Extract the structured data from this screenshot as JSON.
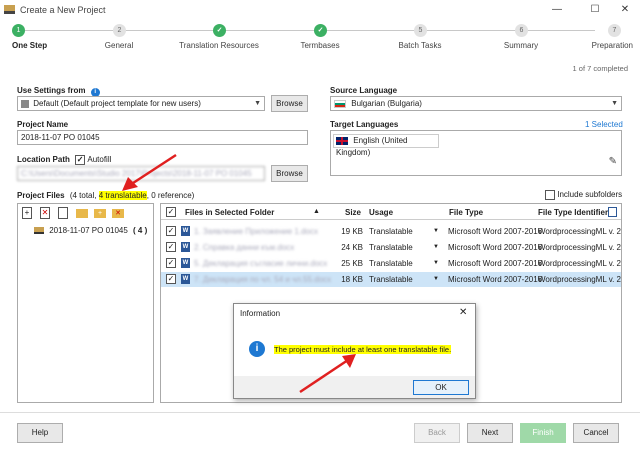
{
  "window": {
    "title": "Create a New Project"
  },
  "steps": [
    {
      "num": "1",
      "label": "One Step",
      "state": "current"
    },
    {
      "num": "2",
      "label": "General",
      "state": "todo"
    },
    {
      "num": "✓",
      "label": "Translation Resources",
      "state": "done"
    },
    {
      "num": "✓",
      "label": "Termbases",
      "state": "done"
    },
    {
      "num": "5",
      "label": "Batch Tasks",
      "state": "todo"
    },
    {
      "num": "6",
      "label": "Summary",
      "state": "todo"
    },
    {
      "num": "7",
      "label": "Preparation",
      "state": "todo"
    }
  ],
  "progress": "1 of 7 completed",
  "settings": {
    "use_settings_label": "Use Settings from",
    "use_settings_value": "Default (Default project template for new users)",
    "browse_label": "Browse",
    "project_name_label": "Project Name",
    "project_name_value": "2018-11-07 PO 01045",
    "location_label": "Location Path",
    "autofill_label": "Autofill",
    "location_value": "C:\\Users\\Documents\\Studio 2017\\Projects\\2018-11-07 PO 01045"
  },
  "languages": {
    "source_label": "Source Language",
    "source_value": "Bulgarian (Bulgaria)",
    "target_label": "Target Languages",
    "target_selected": "1 Selected",
    "target_value": "English (United Kingdom)"
  },
  "files": {
    "label": "Project Files",
    "count_prefix": "(4 total, ",
    "count_highlight": "4 translatable",
    "count_suffix": ", 0 reference)",
    "include_subfolders": "Include subfolders",
    "tree_item": "2018-11-07 PO 01045",
    "tree_count": "( 4 )",
    "columns": {
      "name": "Files in Selected Folder",
      "size": "Size",
      "usage": "Usage",
      "type": "File Type",
      "identifier": "File Type Identifier"
    },
    "rows": [
      {
        "name": "1. Заявление Приложение 1.docx",
        "size": "19 KB",
        "usage": "Translatable",
        "type": "Microsoft Word 2007-2016",
        "identifier": "WordprocessingML v. 2"
      },
      {
        "name": "2. Справка данни към.docx",
        "size": "24 KB",
        "usage": "Translatable",
        "type": "Microsoft Word 2007-2016",
        "identifier": "WordprocessingML v. 2"
      },
      {
        "name": "5. Декларация съгласие лични.docx",
        "size": "25 KB",
        "usage": "Translatable",
        "type": "Microsoft Word 2007-2016",
        "identifier": "WordprocessingML v. 2"
      },
      {
        "name": "7. Декларация по чл. 54 и чл.55.docx",
        "size": "18 KB",
        "usage": "Translatable",
        "type": "Microsoft Word 2007-2016",
        "identifier": "WordprocessingML v. 2"
      }
    ]
  },
  "dialog": {
    "title": "Information",
    "message": "The project must include at least one translatable file.",
    "ok_label": "OK"
  },
  "footer": {
    "help": "Help",
    "back": "Back",
    "next": "Next",
    "finish": "Finish",
    "cancel": "Cancel"
  },
  "colors": {
    "accent_green": "#3cb063",
    "highlight_yellow": "#ffff00",
    "info_blue": "#1e78d2",
    "arrow_red": "#e02020",
    "selected_row": "#cde4f7"
  }
}
